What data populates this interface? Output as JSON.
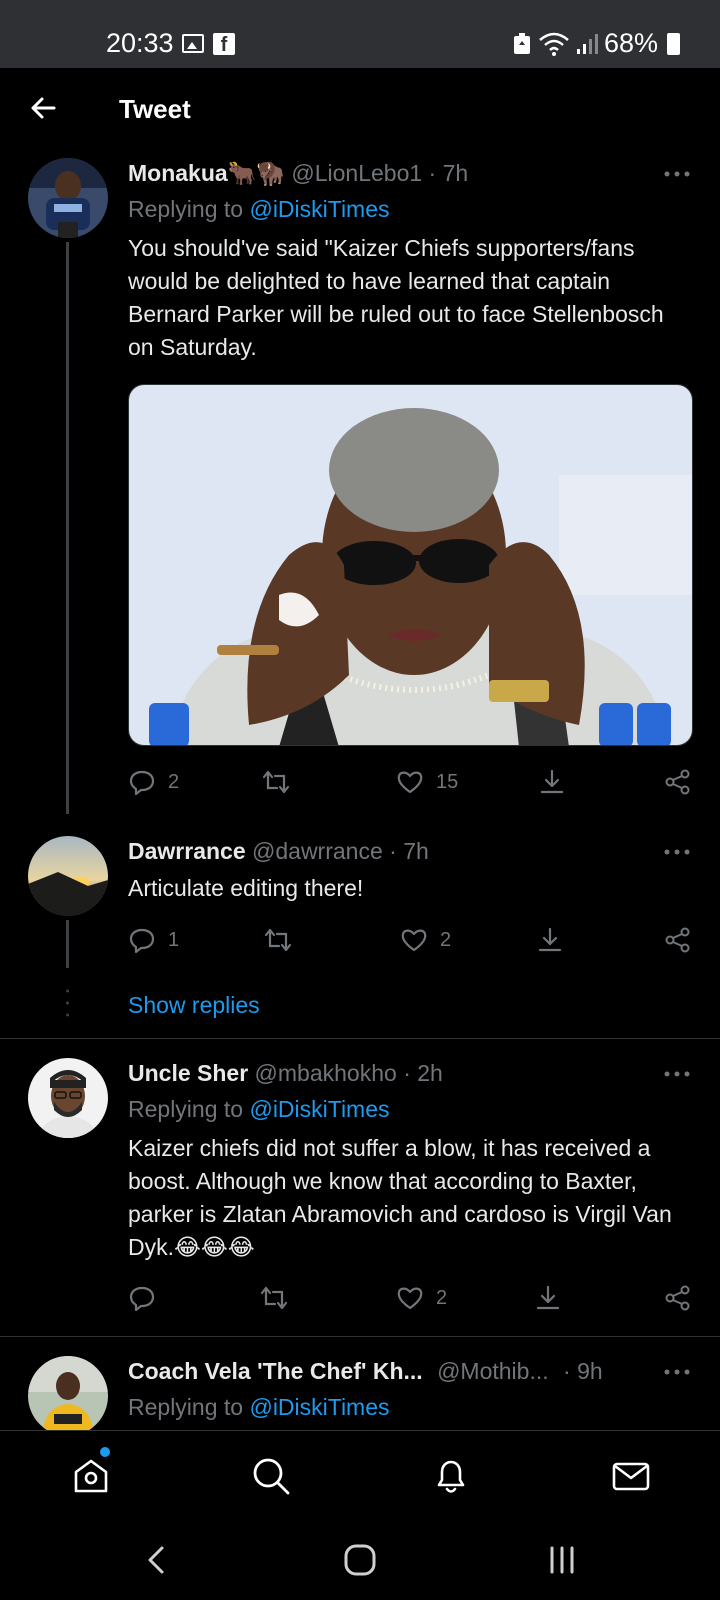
{
  "status_bar": {
    "time": "20:33",
    "battery": "68%",
    "icons": [
      "gallery-icon",
      "facebook-icon",
      "battery-saver-icon",
      "wifi-icon",
      "signal-icon",
      "battery-icon"
    ]
  },
  "header": {
    "title": "Tweet",
    "back_icon": "back-arrow-icon"
  },
  "tweets": [
    {
      "name": "Monakua🐂🦬",
      "handle": "@LionLebo1",
      "time": "· 7h",
      "replying_prefix": "Replying to ",
      "replying_to": "@iDiskiTimes",
      "text": "You should've said \"Kaizer Chiefs supporters/fans would be delighted to have learned that captain Bernard Parker will be ruled out to face Stellenbosch on Saturday.",
      "replies": "2",
      "retweets": "",
      "likes": "15"
    },
    {
      "name": "Dawrrance",
      "handle": "@dawrrance",
      "time": "· 7h",
      "text": "Articulate editing there!",
      "replies": "1",
      "retweets": "",
      "likes": "2",
      "show_replies": "Show replies"
    },
    {
      "name": "Uncle Sher",
      "handle": "@mbakhokho",
      "time": "· 2h",
      "replying_prefix": "Replying to ",
      "replying_to": "@iDiskiTimes",
      "text": "Kaizer chiefs did not suffer a blow, it has received a boost.  Although we know that according to Baxter, parker is Zlatan Abramovich and cardoso is Virgil Van Dyk.😂😂😂",
      "replies": "",
      "retweets": "",
      "likes": "2"
    },
    {
      "name": "Coach Vela 'The Chef' Kh...",
      "handle": "@Mothib...",
      "time": "· 9h",
      "replying_prefix": "Replying to ",
      "replying_to": "@iDiskiTimes"
    }
  ],
  "bottom_nav": [
    "home-icon",
    "search-icon",
    "notifications-icon",
    "messages-icon"
  ],
  "colors": {
    "accent": "#1d9bf0",
    "muted": "#71767b",
    "background": "#000000"
  }
}
